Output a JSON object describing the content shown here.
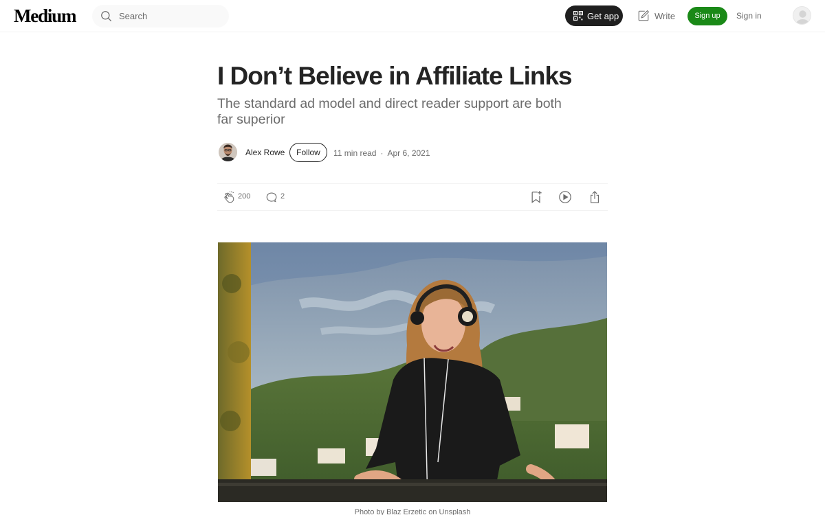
{
  "header": {
    "logo": "Medium",
    "search_placeholder": "Search",
    "get_app_label": "Get app",
    "write_label": "Write",
    "sign_up_label": "Sign up",
    "sign_in_label": "Sign in"
  },
  "article": {
    "title": "I Don’t Believe in Affiliate Links",
    "subtitle": "The standard ad model and direct reader support are both far superior",
    "author": "Alex Rowe",
    "follow_label": "Follow",
    "read_time": "11 min read",
    "separator": "·",
    "date": "Apr 6, 2021",
    "claps": "200",
    "responses": "2",
    "image_caption": "Photo by Blaz Erzetic on Unsplash"
  },
  "colors": {
    "accent_green": "#1a8917",
    "dark_button": "#1f1f1f",
    "text_primary": "#242424",
    "text_secondary": "#6b6b6b"
  },
  "icons": [
    "search-icon",
    "qr-code-icon",
    "write-icon",
    "user-avatar-icon",
    "clap-icon",
    "response-icon",
    "bookmark-icon",
    "play-icon",
    "share-icon"
  ]
}
